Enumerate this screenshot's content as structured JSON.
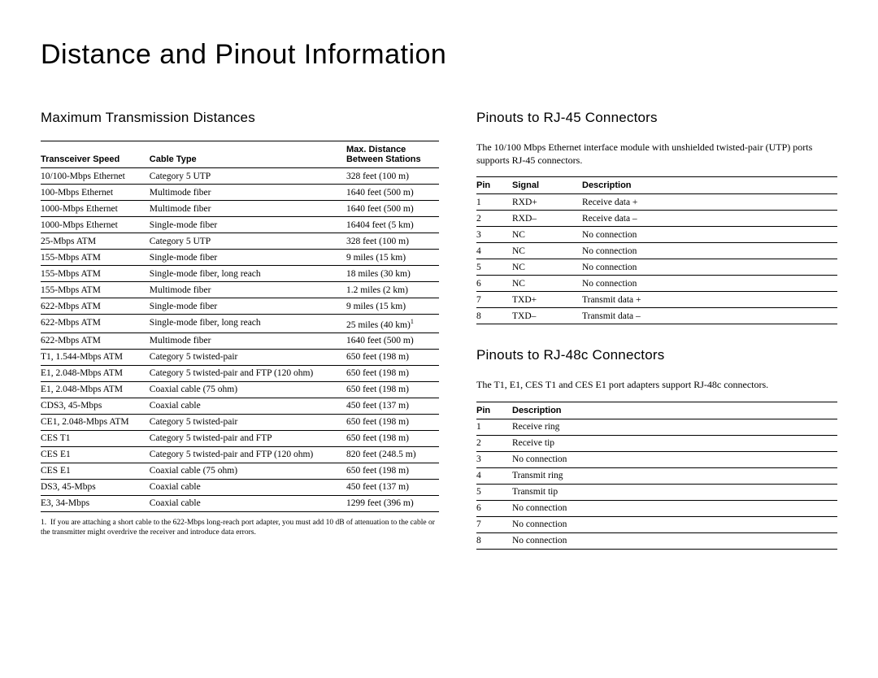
{
  "title": "Distance and Pinout Information",
  "left": {
    "heading": "Maximum Transmission Distances",
    "headers": {
      "speed": "Transceiver Speed",
      "cable": "Cable Type",
      "dist1": "Max. Distance",
      "dist2": "Between Stations"
    },
    "rows": [
      {
        "s": "10/100-Mbps Ethernet",
        "c": "Category 5 UTP",
        "d": "328 feet (100 m)",
        "sup": ""
      },
      {
        "s": "100-Mbps Ethernet",
        "c": "Multimode fiber",
        "d": "1640 feet (500 m)",
        "sup": ""
      },
      {
        "s": "1000-Mbps Ethernet",
        "c": "Multimode fiber",
        "d": "1640 feet (500 m)",
        "sup": ""
      },
      {
        "s": "1000-Mbps Ethernet",
        "c": "Single-mode fiber",
        "d": "16404 feet (5 km)",
        "sup": ""
      },
      {
        "s": "25-Mbps ATM",
        "c": "Category 5 UTP",
        "d": "328 feet (100 m)",
        "sup": ""
      },
      {
        "s": "155-Mbps ATM",
        "c": "Single-mode fiber",
        "d": "9 miles (15 km)",
        "sup": ""
      },
      {
        "s": "155-Mbps ATM",
        "c": "Single-mode fiber, long reach",
        "d": "18 miles (30 km)",
        "sup": ""
      },
      {
        "s": "155-Mbps ATM",
        "c": "Multimode fiber",
        "d": "1.2 miles (2 km)",
        "sup": ""
      },
      {
        "s": "622-Mbps ATM",
        "c": "Single-mode fiber",
        "d": "9 miles (15 km)",
        "sup": ""
      },
      {
        "s": "622-Mbps ATM",
        "c": "Single-mode fiber, long reach",
        "d": "25 miles (40 km)",
        "sup": "1"
      },
      {
        "s": "622-Mbps ATM",
        "c": "Multimode fiber",
        "d": "1640 feet (500 m)",
        "sup": ""
      },
      {
        "s": "T1, 1.544-Mbps ATM",
        "c": "Category 5 twisted-pair",
        "d": "650 feet (198 m)",
        "sup": ""
      },
      {
        "s": "E1, 2.048-Mbps ATM",
        "c": "Category 5 twisted-pair and FTP (120 ohm)",
        "d": "650 feet (198 m)",
        "sup": ""
      },
      {
        "s": "E1, 2.048-Mbps ATM",
        "c": "Coaxial cable (75 ohm)",
        "d": "650 feet (198 m)",
        "sup": ""
      },
      {
        "s": "CDS3, 45-Mbps",
        "c": "Coaxial cable",
        "d": "450 feet (137 m)",
        "sup": ""
      },
      {
        "s": "CE1, 2.048-Mbps ATM",
        "c": "Category 5 twisted-pair",
        "d": "650 feet (198 m)",
        "sup": ""
      },
      {
        "s": "CES T1",
        "c": "Category 5 twisted-pair and FTP",
        "d": "650 feet (198 m)",
        "sup": ""
      },
      {
        "s": "CES E1",
        "c": "Category 5 twisted-pair and FTP (120 ohm)",
        "d": "820 feet (248.5 m)",
        "sup": ""
      },
      {
        "s": "CES E1",
        "c": "Coaxial cable (75 ohm)",
        "d": "650 feet (198 m)",
        "sup": ""
      },
      {
        "s": "DS3, 45-Mbps",
        "c": "Coaxial cable",
        "d": "450 feet (137 m)",
        "sup": ""
      },
      {
        "s": "E3, 34-Mbps",
        "c": "Coaxial cable",
        "d": "1299 feet (396 m)",
        "sup": ""
      }
    ],
    "footnote_num": "1.",
    "footnote": "If you are attaching a short cable to the 622-Mbps long-reach port adapter, you must add 10 dB of attenuation to the cable or the transmitter might overdrive the receiver and introduce data errors."
  },
  "rj45": {
    "heading": "Pinouts to RJ-45 Connectors",
    "intro": "The 10/100 Mbps Ethernet interface module with unshielded twisted-pair (UTP) ports supports RJ-45 connectors.",
    "headers": {
      "pin": "Pin",
      "signal": "Signal",
      "desc": "Description"
    },
    "rows": [
      {
        "p": "1",
        "s": "RXD+",
        "d": "Receive data +"
      },
      {
        "p": "2",
        "s": "RXD–",
        "d": "Receive data –"
      },
      {
        "p": "3",
        "s": "NC",
        "d": "No connection"
      },
      {
        "p": "4",
        "s": "NC",
        "d": "No connection"
      },
      {
        "p": "5",
        "s": "NC",
        "d": "No connection"
      },
      {
        "p": "6",
        "s": "NC",
        "d": "No connection"
      },
      {
        "p": "7",
        "s": "TXD+",
        "d": "Transmit data +"
      },
      {
        "p": "8",
        "s": "TXD–",
        "d": "Transmit data –"
      }
    ]
  },
  "rj48c": {
    "heading": "Pinouts to RJ-48c Connectors",
    "intro": "The T1, E1, CES T1 and CES E1 port adapters support RJ-48c connectors.",
    "headers": {
      "pin": "Pin",
      "desc": "Description"
    },
    "rows": [
      {
        "p": "1",
        "d": "Receive ring"
      },
      {
        "p": "2",
        "d": "Receive tip"
      },
      {
        "p": "3",
        "d": "No connection"
      },
      {
        "p": "4",
        "d": "Transmit ring"
      },
      {
        "p": "5",
        "d": "Transmit tip"
      },
      {
        "p": "6",
        "d": "No connection"
      },
      {
        "p": "7",
        "d": "No connection"
      },
      {
        "p": "8",
        "d": "No connection"
      }
    ]
  }
}
